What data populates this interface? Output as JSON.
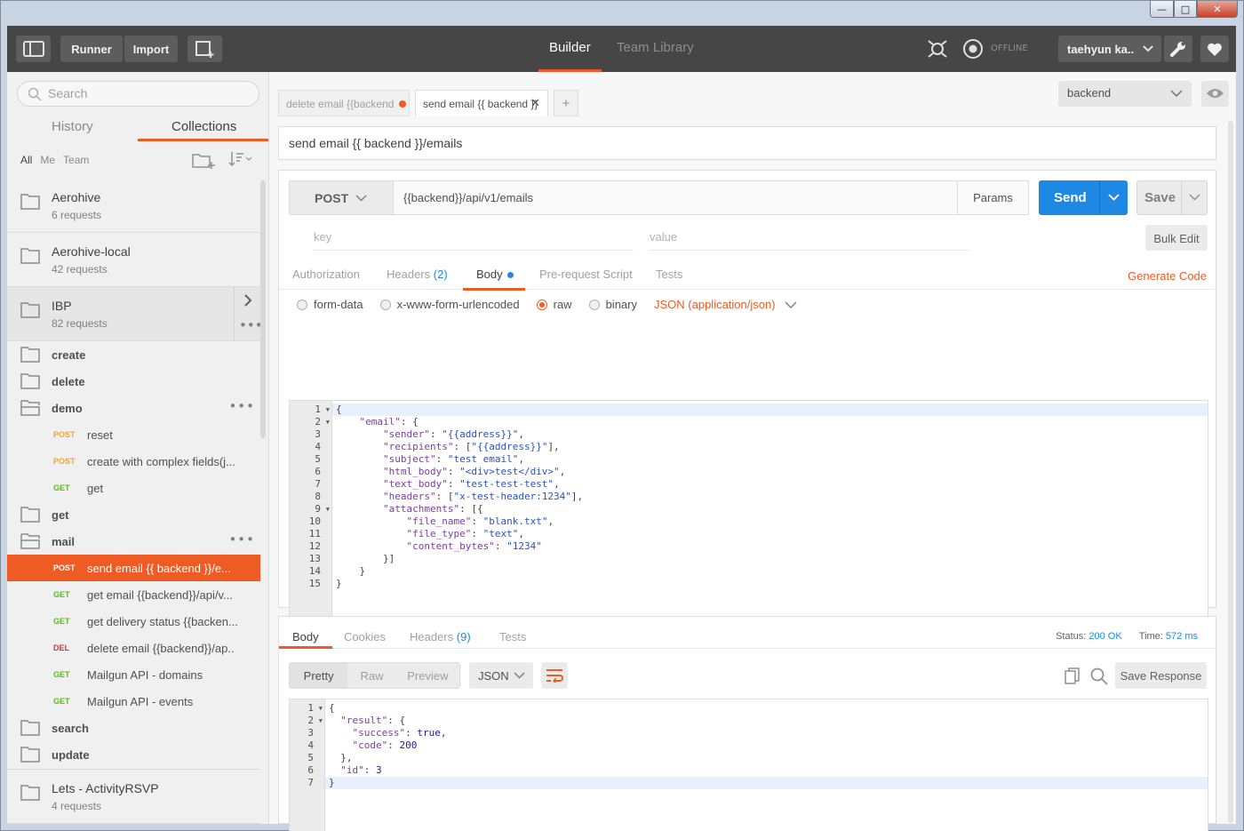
{
  "header": {
    "runner": "Runner",
    "import": "Import",
    "tabs": [
      "Builder",
      "Team Library"
    ],
    "offline": "OFFLINE",
    "user": "taehyun ka.."
  },
  "sidebar": {
    "search_placeholder": "Search",
    "tabs": [
      "History",
      "Collections"
    ],
    "filters": [
      "All",
      "Me",
      "Team"
    ],
    "collections": [
      {
        "name": "Aerohive",
        "count": "6 requests"
      },
      {
        "name": "Aerohive-local",
        "count": "42 requests"
      },
      {
        "name": "IBP",
        "count": "82 requests"
      }
    ],
    "ibp_folders": {
      "create": "create",
      "delete": "delete",
      "demo": "demo",
      "get": "get",
      "mail": "mail",
      "search": "search",
      "update": "update"
    },
    "demo_requests": [
      {
        "method": "POST",
        "name": "reset"
      },
      {
        "method": "POST",
        "name": "create with complex fields(j..."
      },
      {
        "method": "GET",
        "name": "get"
      }
    ],
    "mail_requests": [
      {
        "method": "POST",
        "name": "send email {{ backend }}/e..."
      },
      {
        "method": "GET",
        "name": "get email {{backend}}/api/v..."
      },
      {
        "method": "GET",
        "name": "get delivery status {{backen..."
      },
      {
        "method": "DEL",
        "name": "delete email {{backend}}/ap.."
      },
      {
        "method": "GET",
        "name": "Mailgun API - domains"
      },
      {
        "method": "GET",
        "name": "Mailgun API - events"
      }
    ],
    "last_collection": {
      "name": "Lets - ActivityRSVP",
      "count": "4 requests"
    }
  },
  "main": {
    "tabs": [
      "delete email {{backend",
      "send email {{ backend }}"
    ],
    "environment": "backend",
    "request_name": "send email {{ backend }}/emails",
    "method": "POST",
    "url": "{{backend}}/api/v1/emails",
    "params": "Params",
    "send": "Send",
    "save": "Save",
    "key_placeholder": "key",
    "value_placeholder": "value",
    "bulk_edit": "Bulk Edit",
    "subtabs": {
      "authorization": "Authorization",
      "headers": "Headers",
      "headers_count": "(2)",
      "body": "Body",
      "prerequest": "Pre-request Script",
      "tests": "Tests"
    },
    "generate_code": "Generate Code",
    "body_modes": [
      "form-data",
      "x-www-form-urlencoded",
      "raw",
      "binary"
    ],
    "content_type": "JSON (application/json)",
    "request_body": [
      "{",
      "    \"email\": {",
      "        \"sender\": \"{{address}}\",",
      "        \"recipients\": [\"{{address}}\"],",
      "        \"subject\": \"test email\",",
      "        \"html_body\": \"<div>test</div>\",",
      "        \"text_body\": \"test-test-test\",",
      "        \"headers\": [\"x-test-header:1234\"],",
      "        \"attachments\": [{",
      "            \"file_name\": \"blank.txt\",",
      "            \"file_type\": \"text\",",
      "            \"content_bytes\": \"1234\"",
      "        }]",
      "    }",
      "}"
    ]
  },
  "response": {
    "tabs": {
      "body": "Body",
      "cookies": "Cookies",
      "headers": "Headers",
      "headers_count": "(9)",
      "tests": "Tests"
    },
    "status_label": "Status:",
    "status": "200 OK",
    "time_label": "Time:",
    "time": "572 ms",
    "views": [
      "Pretty",
      "Raw",
      "Preview"
    ],
    "format": "JSON",
    "save_response": "Save Response",
    "body": [
      "{",
      "  \"result\": {",
      "    \"success\": true,",
      "    \"code\": 200",
      "  },",
      "  \"id\": 3",
      "}"
    ]
  },
  "colors": {
    "accent": "#ef5b25",
    "send": "#1e88e5",
    "post": "#f5a623",
    "get": "#55c10f",
    "del": "#e32c2c"
  }
}
